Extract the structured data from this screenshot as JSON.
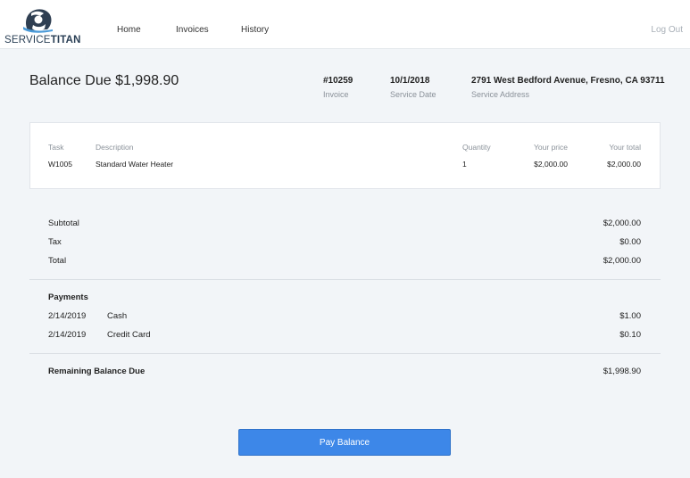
{
  "header": {
    "logo": {
      "text_light": "SERVICE",
      "text_bold": "TITAN"
    },
    "nav": {
      "home": "Home",
      "invoices": "Invoices",
      "history": "History"
    },
    "logout": "Log Out"
  },
  "invoice": {
    "title": "Balance Due $1,998.90",
    "number": "#10259",
    "number_label": "Invoice",
    "service_date": "10/1/2018",
    "service_date_label": "Service Date",
    "service_address": "2791 West Bedford Avenue, Fresno, CA 93711",
    "service_address_label": "Service Address"
  },
  "line_items": {
    "headers": {
      "task": "Task",
      "description": "Description",
      "quantity": "Quantity",
      "price": "Your price",
      "total": "Your total"
    },
    "rows": [
      {
        "task": "W1005",
        "description": "Standard Water Heater",
        "quantity": "1",
        "price": "$2,000.00",
        "total": "$2,000.00"
      }
    ]
  },
  "summary": {
    "subtotal_label": "Subtotal",
    "subtotal": "$2,000.00",
    "tax_label": "Tax",
    "tax": "$0.00",
    "total_label": "Total",
    "total": "$2,000.00"
  },
  "payments": {
    "heading": "Payments",
    "items": [
      {
        "date": "2/14/2019",
        "method": "Cash",
        "amount": "$1.00"
      },
      {
        "date": "2/14/2019",
        "method": "Credit Card",
        "amount": "$0.10"
      }
    ]
  },
  "remaining": {
    "label": "Remaining Balance Due",
    "amount": "$1,998.90"
  },
  "actions": {
    "pay_label": "Pay Balance"
  }
}
